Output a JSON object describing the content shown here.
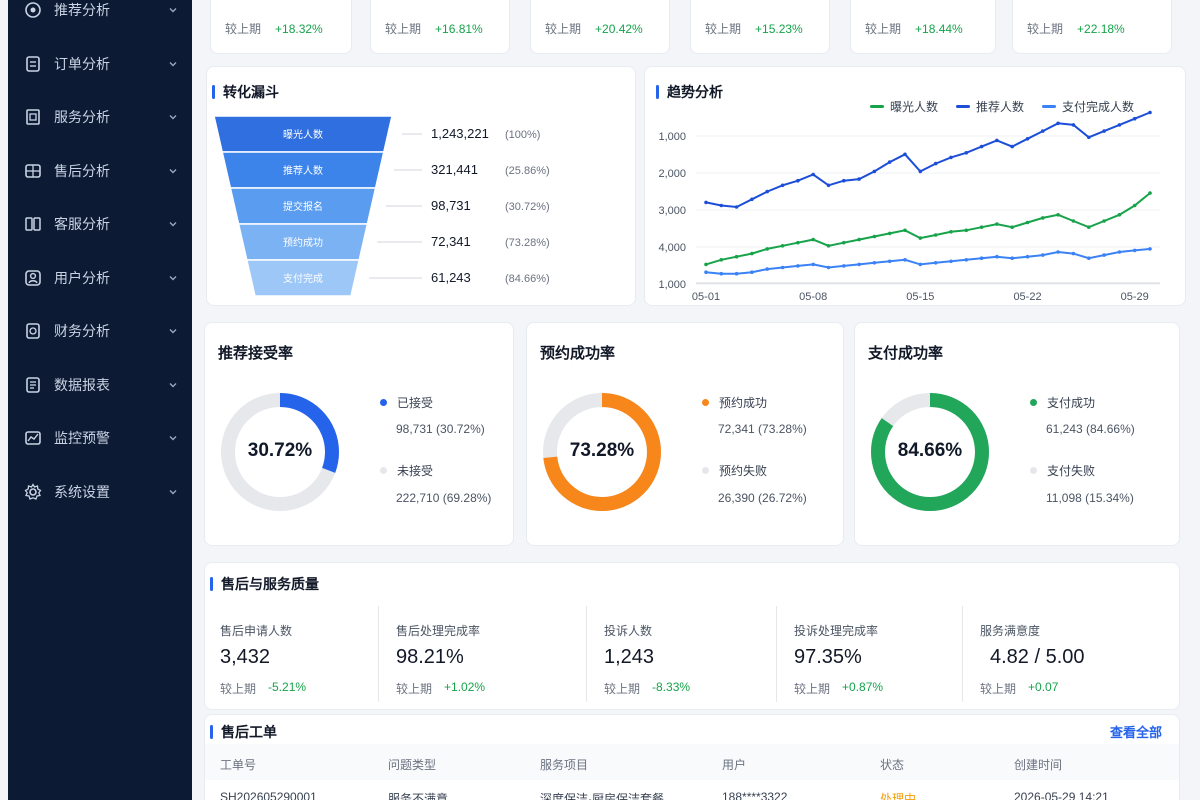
{
  "sidebar": {
    "items": [
      {
        "label": "推荐分析",
        "icon": "target-icon"
      },
      {
        "label": "订单分析",
        "icon": "order-icon"
      },
      {
        "label": "服务分析",
        "icon": "service-icon"
      },
      {
        "label": "售后分析",
        "icon": "after-sales-icon"
      },
      {
        "label": "客服分析",
        "icon": "customer-service-icon"
      },
      {
        "label": "用户分析",
        "icon": "user-icon"
      },
      {
        "label": "财务分析",
        "icon": "finance-icon"
      },
      {
        "label": "数据报表",
        "icon": "report-icon"
      },
      {
        "label": "监控预警",
        "icon": "monitor-icon"
      },
      {
        "label": "系统设置",
        "icon": "gear-icon"
      }
    ]
  },
  "kpis": [
    {
      "label": "较上期",
      "change": "+18.32%"
    },
    {
      "label": "较上期",
      "change": "+16.81%"
    },
    {
      "label": "较上期",
      "change": "+20.42%"
    },
    {
      "label": "较上期",
      "change": "+15.23%"
    },
    {
      "label": "较上期",
      "change": "+18.44%"
    },
    {
      "label": "较上期",
      "change": "+22.18%"
    }
  ],
  "funnel": {
    "title": "转化漏斗",
    "stages": [
      {
        "label": "曝光人数",
        "value": "1,243,221",
        "pct": "(100%)",
        "fraction": 1.0
      },
      {
        "label": "推荐人数",
        "value": "321,441",
        "pct": "(25.86%)",
        "fraction": 0.2586
      },
      {
        "label": "提交报名",
        "value": "98,731",
        "pct": "(30.72%)",
        "fraction": 0.3072
      },
      {
        "label": "预约成功",
        "value": "72,341",
        "pct": "(73.28%)",
        "fraction": 0.7328
      },
      {
        "label": "支付完成",
        "value": "61,243",
        "pct": "(84.66%)",
        "fraction": 0.8466
      }
    ],
    "colors": [
      "#2f6fe0",
      "#3d84ea",
      "#5a9cf0",
      "#7bb2f4",
      "#9cc7f7"
    ]
  },
  "trend": {
    "title": "趋势分析",
    "chart_data": {
      "type": "line",
      "x": [
        "05-01",
        "05-02",
        "05-03",
        "05-04",
        "05-05",
        "05-06",
        "05-07",
        "05-08",
        "05-09",
        "05-10",
        "05-11",
        "05-12",
        "05-13",
        "05-14",
        "05-15",
        "05-16",
        "05-17",
        "05-18",
        "05-19",
        "05-20",
        "05-21",
        "05-22",
        "05-23",
        "05-24",
        "05-25",
        "05-26",
        "05-27",
        "05-28",
        "05-29",
        "05-30"
      ],
      "x_ticks": [
        "05-01",
        "05-08",
        "05-15",
        "05-22",
        "05-29"
      ],
      "y_ticks": [
        "1,000",
        "2,000",
        "3,000",
        "4,000",
        "1,000"
      ],
      "ylim": [
        0,
        5000
      ],
      "series": [
        {
          "name": "曝光人数",
          "color": "#16a34a",
          "values": [
            600,
            750,
            850,
            950,
            1100,
            1200,
            1300,
            1400,
            1200,
            1300,
            1400,
            1500,
            1600,
            1700,
            1450,
            1550,
            1650,
            1700,
            1800,
            1900,
            1800,
            1950,
            2100,
            2200,
            2000,
            1800,
            2000,
            2200,
            2500,
            2900
          ]
        },
        {
          "name": "推荐人数",
          "color": "#1d4ed8",
          "values": [
            2600,
            2500,
            2450,
            2700,
            2950,
            3150,
            3300,
            3500,
            3150,
            3300,
            3350,
            3600,
            3900,
            4150,
            3600,
            3850,
            4050,
            4200,
            4400,
            4600,
            4400,
            4650,
            4900,
            5150,
            5100,
            4700,
            4900,
            5100,
            5300,
            5500
          ]
        },
        {
          "name": "支付完成人数",
          "color": "#3b82f6",
          "values": [
            350,
            300,
            300,
            350,
            450,
            500,
            550,
            600,
            500,
            550,
            600,
            650,
            700,
            750,
            600,
            650,
            700,
            750,
            800,
            850,
            800,
            850,
            900,
            1000,
            950,
            800,
            900,
            1000,
            1050,
            1100
          ]
        }
      ]
    }
  },
  "rates": [
    {
      "title": "推荐接受率",
      "center": "30.72%",
      "fraction": 0.3072,
      "color": "#2563eb",
      "a_label": "已接受",
      "a_value": "98,731 (30.72%)",
      "b_label": "未接受",
      "b_value": "222,710 (69.28%)"
    },
    {
      "title": "预约成功率",
      "center": "73.28%",
      "fraction": 0.7328,
      "color": "#f7861b",
      "a_label": "预约成功",
      "a_value": "72,341 (73.28%)",
      "b_label": "预约失败",
      "b_value": "26,390 (26.72%)"
    },
    {
      "title": "支付成功率",
      "center": "84.66%",
      "fraction": 0.8466,
      "color": "#22a65a",
      "a_label": "支付成功",
      "a_value": "61,243 (84.66%)",
      "b_label": "支付失败",
      "b_value": "11,098 (15.34%)"
    }
  ],
  "service_quality": {
    "title": "售后与服务质量",
    "items": [
      {
        "label": "售后申请人数",
        "value": "3,432",
        "cmp": "较上期",
        "change": "-5.21%"
      },
      {
        "label": "售后处理完成率",
        "value": "98.21%",
        "cmp": "较上期",
        "change": "+1.02%"
      },
      {
        "label": "投诉人数",
        "value": "1,243",
        "cmp": "较上期",
        "change": "-8.33%"
      },
      {
        "label": "投诉处理完成率",
        "value": "97.35%",
        "cmp": "较上期",
        "change": "+0.87%"
      },
      {
        "label": "服务满意度",
        "value": "4.82 / 5.00",
        "cmp": "较上期",
        "change": "+0.07"
      }
    ]
  },
  "work_orders": {
    "title": "售后工单",
    "view_all": "查看全部",
    "columns": [
      "工单号",
      "问题类型",
      "服务项目",
      "用户",
      "状态",
      "创建时间"
    ],
    "rows": [
      [
        "SH202605290001",
        "服务不满意",
        "深度保洁·厨房保洁套餐",
        "188****3322",
        "处理中",
        "2026-05-29 14:21"
      ]
    ]
  }
}
